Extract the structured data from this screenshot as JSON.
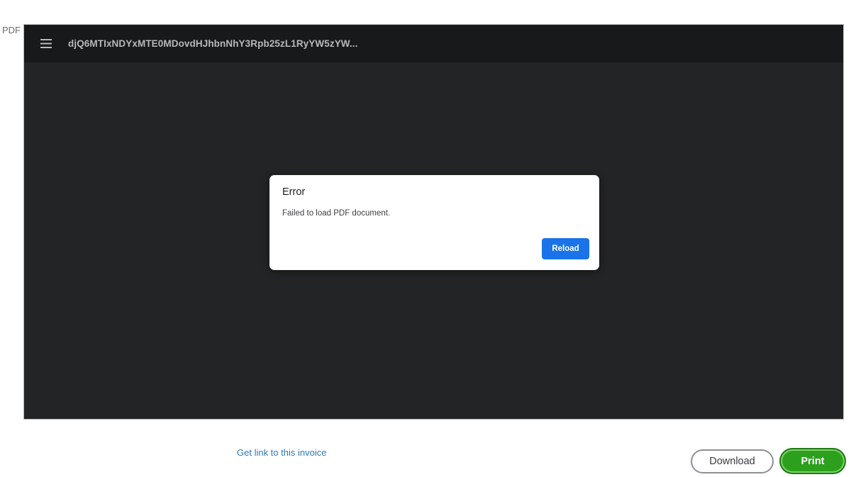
{
  "frame": {
    "label": "PDF"
  },
  "viewer": {
    "menu_icon": "hamburger-menu-icon",
    "document_title": "djQ6MTIxNDYxMTE0MDovdHJhbnNhY3Rpb25zL1RyYW5zYW...",
    "background_color": "#232425",
    "toolbar_color": "#18191a"
  },
  "error_dialog": {
    "title": "Error",
    "message": "Failed to load PDF document.",
    "reload_label": "Reload",
    "reload_color": "#1a73e8"
  },
  "footer": {
    "get_link_label": "Get link to this invoice",
    "download_label": "Download",
    "print_label": "Print",
    "print_color": "#2ca01c",
    "link_color": "#2c79b8"
  }
}
